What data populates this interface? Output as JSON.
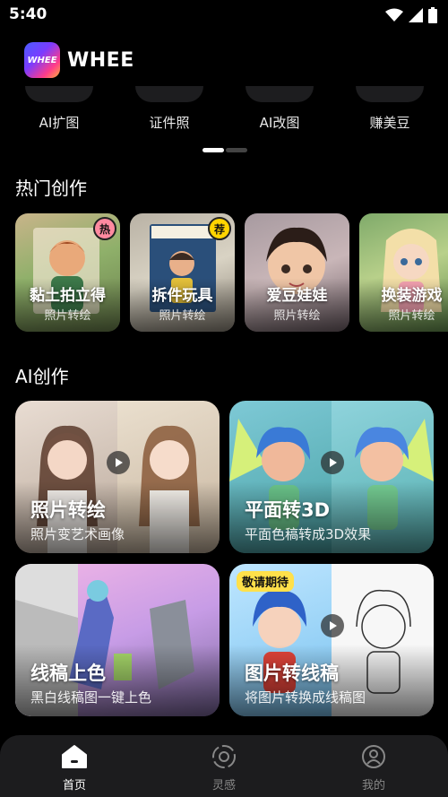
{
  "status_bar": {
    "time": "5:40"
  },
  "header": {
    "logo_badge_text": "WHEE",
    "app_name": "WHEE"
  },
  "tools": [
    {
      "label": "AI扩图"
    },
    {
      "label": "证件照"
    },
    {
      "label": "AI改图"
    },
    {
      "label": "赚美豆"
    }
  ],
  "sections": {
    "hot": "热门创作",
    "ai": "AI创作"
  },
  "hot_cards": [
    {
      "title": "黏土拍立得",
      "subtitle": "照片转绘",
      "badge": "热"
    },
    {
      "title": "拆件玩具",
      "subtitle": "照片转绘",
      "badge": "荐"
    },
    {
      "title": "爱豆娃娃",
      "subtitle": "照片转绘",
      "badge": ""
    },
    {
      "title": "换装游戏",
      "subtitle": "照片转绘",
      "badge": ""
    }
  ],
  "ai_cards": [
    {
      "title": "照片转绘",
      "subtitle": "照片变艺术画像"
    },
    {
      "title": "平面转3D",
      "subtitle": "平面色稿转成3D效果"
    },
    {
      "title": "线稿上色",
      "subtitle": "黑白线稿图一键上色"
    },
    {
      "title": "图片转线稿",
      "subtitle": "将图片转换成线稿图",
      "tag": "敬请期待"
    }
  ],
  "bottom_nav": [
    {
      "label": "首页",
      "icon": "home-icon",
      "active": true
    },
    {
      "label": "灵感",
      "icon": "inspiration-icon",
      "active": false
    },
    {
      "label": "我的",
      "icon": "profile-icon",
      "active": false
    }
  ],
  "colors": {
    "background": "#000000",
    "nav_bg": "#1c1c1e",
    "hot_badge": "#ff8aa0",
    "rec_badge": "#ffd400",
    "coming_tag": "#ffe04a"
  }
}
